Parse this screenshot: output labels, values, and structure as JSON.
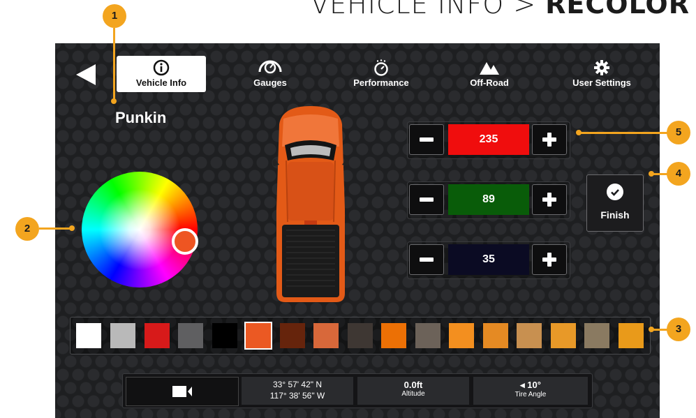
{
  "page_title": {
    "prefix": "VEHICLE INFO > ",
    "strong": "RECOLOR"
  },
  "nav": {
    "items": [
      {
        "label": "Vehicle Info",
        "icon": "info-icon",
        "active": true
      },
      {
        "label": "Gauges",
        "icon": "gauge-icon",
        "active": false
      },
      {
        "label": "Performance",
        "icon": "stopwatch-icon",
        "active": false
      },
      {
        "label": "Off-Road",
        "icon": "mountain-icon",
        "active": false
      },
      {
        "label": "User Settings",
        "icon": "gear-icon",
        "active": false
      }
    ]
  },
  "vehicle_name": "Punkin",
  "rgb": {
    "red": {
      "value": "235",
      "color": "#f00d0d"
    },
    "green": {
      "value": "89",
      "color": "#095c09"
    },
    "blue": {
      "value": "35",
      "color": "#0b0b23"
    }
  },
  "finish_label": "Finish",
  "swatches": [
    {
      "color": "#ffffff"
    },
    {
      "color": "#b9b9b9"
    },
    {
      "color": "#d71a1a"
    },
    {
      "color": "#5f5f61"
    },
    {
      "color": "#000000"
    },
    {
      "color": "#eb5923",
      "selected": true
    },
    {
      "color": "#66240c"
    },
    {
      "color": "#d8683a"
    },
    {
      "color": "#3e3733"
    },
    {
      "color": "#ec7005"
    },
    {
      "color": "#6c6259"
    },
    {
      "color": "#f38f1f"
    },
    {
      "color": "#e58a23"
    },
    {
      "color": "#c89050"
    },
    {
      "color": "#e89928"
    },
    {
      "color": "#8a7a61"
    },
    {
      "color": "#e99a1a"
    }
  ],
  "status": {
    "lat": "33° 57' 42\" N",
    "lon": "117° 38' 56\" W",
    "altitude_value": "0.0ft",
    "altitude_label": "Altitude",
    "tire_angle_value": "◂ 10°",
    "tire_angle_label": "Tire Angle"
  },
  "callouts": [
    "1",
    "2",
    "3",
    "4",
    "5"
  ],
  "accent_color": "#f3a51f"
}
